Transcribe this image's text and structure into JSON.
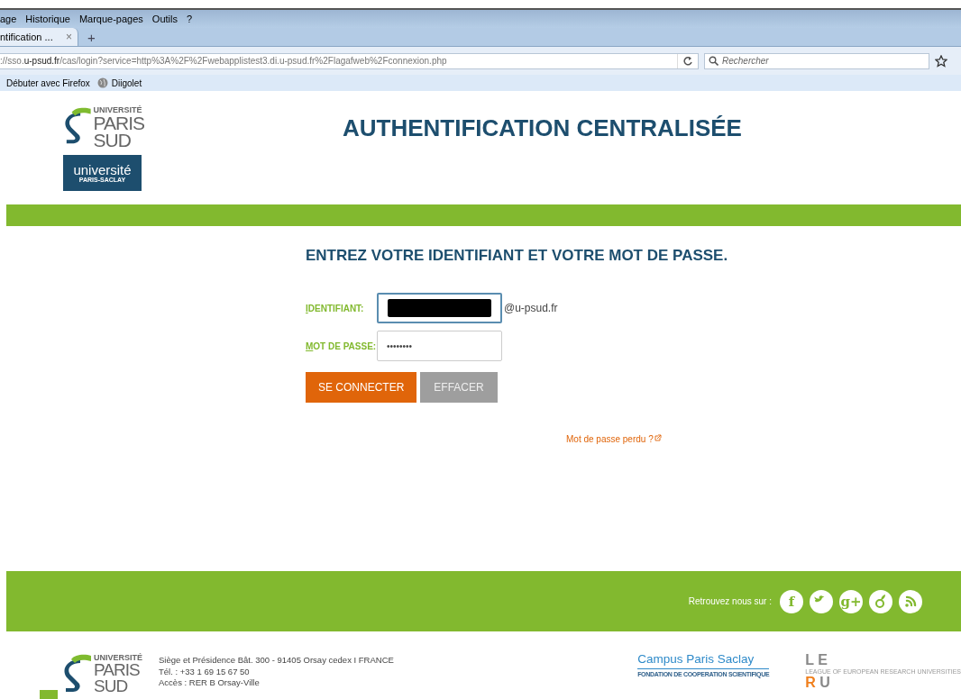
{
  "browser": {
    "menu": [
      {
        "label": "age"
      },
      {
        "label": "Historique"
      },
      {
        "label": "Marque-pages"
      },
      {
        "label": "Outils"
      },
      {
        "label": "?"
      }
    ],
    "tab": {
      "title": "ntification ...",
      "close": "×",
      "new_tab": "+"
    },
    "url": {
      "prefix": "://sso.",
      "domain": "u-psud.fr",
      "rest": "/cas/login?service=http%3A%2F%2Fwebapplistest3.di.u-psud.fr%2Flagafweb%2Fconnexion.php"
    },
    "search": {
      "placeholder": "Rechercher"
    },
    "bookmarks": [
      {
        "label": "Débuter avec Firefox",
        "kind": "plain"
      },
      {
        "label": "Diigolet",
        "kind": "globe"
      }
    ]
  },
  "header": {
    "logo": {
      "line1": "UNIVERSITÉ",
      "line2": "PARIS",
      "line3": "SUD",
      "badge_main": "université",
      "badge_sub": "PARIS-SACLAY"
    },
    "title": "AUTHENTIFICATION CENTRALISÉE"
  },
  "form": {
    "heading": "ENTREZ VOTRE IDENTIFIANT ET VOTRE MOT DE PASSE.",
    "fields": [
      {
        "label": "IDENTIFIANT:",
        "kind": "redacted",
        "focused": true,
        "suffix": "@u-psud.fr"
      },
      {
        "label": "MOT DE PASSE:",
        "kind": "password",
        "focused": false,
        "value": "••••••••"
      }
    ],
    "buttons": [
      {
        "label": "SE CONNECTER",
        "kind": "primary"
      },
      {
        "label": "EFFACER",
        "kind": "secondary"
      }
    ],
    "lost_password": "Mot de passe perdu ?"
  },
  "footer": {
    "follow_label": "Retrouvez nous sur :",
    "social": [
      {
        "kind": "facebook",
        "glyph": "f"
      },
      {
        "kind": "twitter"
      },
      {
        "kind": "google",
        "glyph": "g+"
      },
      {
        "kind": "viadeo"
      },
      {
        "kind": "rss"
      }
    ],
    "logo": {
      "line1": "UNIVERSITÉ",
      "line2": "PARIS",
      "line3": "SUD"
    },
    "address": [
      "Siège et Présidence Bât. 300 - 91405 Orsay cedex I FRANCE",
      "Tél. : +33 1 69 15 67 50",
      "Accès : RER B Orsay-Ville"
    ],
    "campus": {
      "name": "Campus Paris Saclay",
      "sub": "FONDATION DE COOPERATION SCIENTIFIQUE"
    },
    "leru": {
      "top": "L E",
      "middle": "LEAGUE OF EUROPEAN RESEARCH UNIVERSITIES",
      "bottom_r": "R",
      "bottom_u": "U"
    }
  }
}
